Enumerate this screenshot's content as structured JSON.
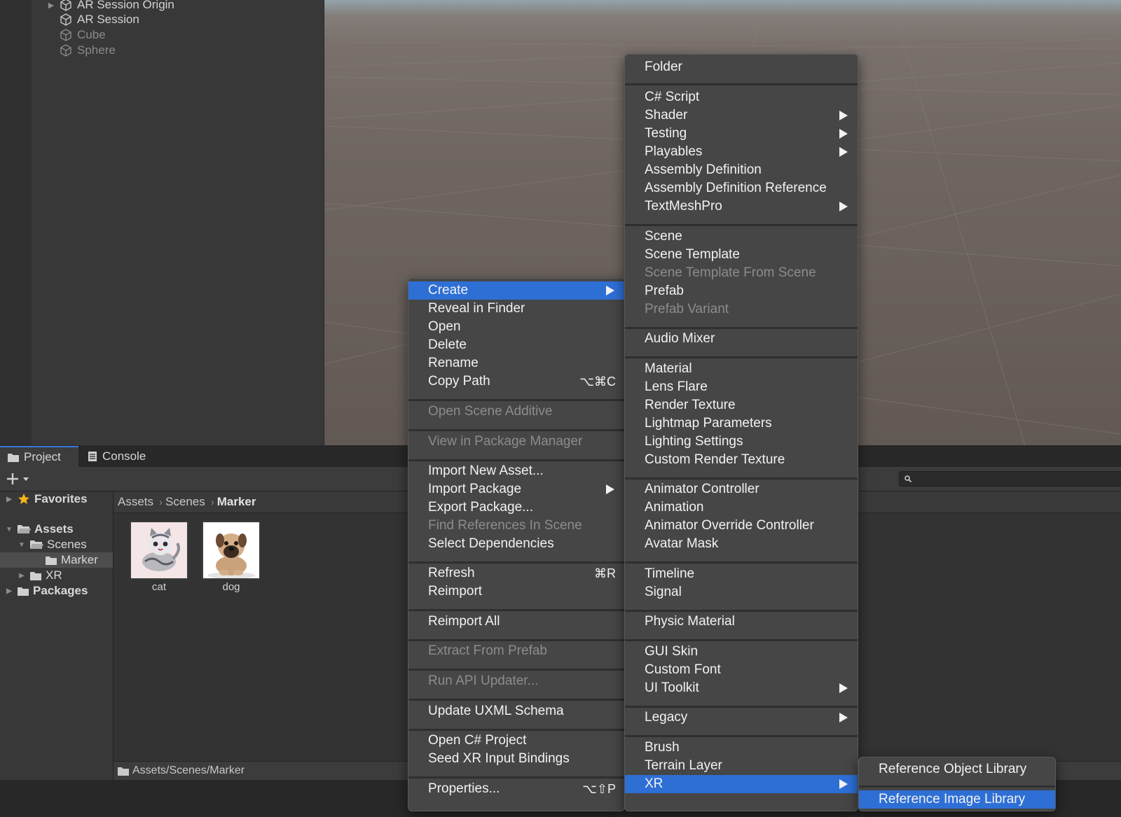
{
  "hierarchy": {
    "items": [
      {
        "label": "AR Session Origin",
        "dim": false,
        "arrow": true
      },
      {
        "label": "AR Session",
        "dim": false,
        "arrow": false
      },
      {
        "label": "Cube",
        "dim": true,
        "arrow": false
      },
      {
        "label": "Sphere",
        "dim": true,
        "arrow": false
      }
    ]
  },
  "project": {
    "tabs": [
      {
        "label": "Project",
        "icon": "folder-icon"
      },
      {
        "label": "Console",
        "icon": "console-icon"
      }
    ],
    "tree": {
      "favorites": "Favorites",
      "assets": "Assets",
      "scenes": "Scenes",
      "marker": "Marker",
      "xr": "XR",
      "packages": "Packages"
    },
    "breadcrumb": [
      "Assets",
      "Scenes",
      "Marker"
    ],
    "assets": [
      {
        "label": "cat"
      },
      {
        "label": "dog"
      }
    ],
    "status_path": "Assets/Scenes/Marker"
  },
  "context_menu": {
    "items": [
      {
        "label": "Create",
        "submenu": true,
        "highlighted": true
      },
      {
        "label": "Reveal in Finder"
      },
      {
        "label": "Open"
      },
      {
        "label": "Delete"
      },
      {
        "label": "Rename"
      },
      {
        "label": "Copy Path",
        "shortcut": "⌥⌘C"
      },
      {
        "label": "Open Scene Additive",
        "disabled": true
      },
      {
        "label": "View in Package Manager",
        "disabled": true
      },
      {
        "label": "Import New Asset..."
      },
      {
        "label": "Import Package",
        "submenu": true
      },
      {
        "label": "Export Package..."
      },
      {
        "label": "Find References In Scene",
        "disabled": true
      },
      {
        "label": "Select Dependencies"
      },
      {
        "label": "Refresh",
        "shortcut": "⌘R"
      },
      {
        "label": "Reimport"
      },
      {
        "label": "Reimport All"
      },
      {
        "label": "Extract From Prefab",
        "disabled": true
      },
      {
        "label": "Run API Updater...",
        "disabled": true
      },
      {
        "label": "Update UXML Schema"
      },
      {
        "label": "Open C# Project"
      },
      {
        "label": "Seed XR Input Bindings"
      },
      {
        "label": "Properties...",
        "shortcut": "⌥⇧P"
      }
    ]
  },
  "create_menu": {
    "items": [
      {
        "label": "Folder"
      },
      {
        "label": "C# Script"
      },
      {
        "label": "Shader",
        "submenu": true
      },
      {
        "label": "Testing",
        "submenu": true
      },
      {
        "label": "Playables",
        "submenu": true
      },
      {
        "label": "Assembly Definition"
      },
      {
        "label": "Assembly Definition Reference"
      },
      {
        "label": "TextMeshPro",
        "submenu": true
      },
      {
        "label": "Scene"
      },
      {
        "label": "Scene Template"
      },
      {
        "label": "Scene Template From Scene",
        "disabled": true
      },
      {
        "label": "Prefab"
      },
      {
        "label": "Prefab Variant",
        "disabled": true
      },
      {
        "label": "Audio Mixer"
      },
      {
        "label": "Material"
      },
      {
        "label": "Lens Flare"
      },
      {
        "label": "Render Texture"
      },
      {
        "label": "Lightmap Parameters"
      },
      {
        "label": "Lighting Settings"
      },
      {
        "label": "Custom Render Texture"
      },
      {
        "label": "Animator Controller"
      },
      {
        "label": "Animation"
      },
      {
        "label": "Animator Override Controller"
      },
      {
        "label": "Avatar Mask"
      },
      {
        "label": "Timeline"
      },
      {
        "label": "Signal"
      },
      {
        "label": "Physic Material"
      },
      {
        "label": "GUI Skin"
      },
      {
        "label": "Custom Font"
      },
      {
        "label": "UI Toolkit",
        "submenu": true
      },
      {
        "label": "Legacy",
        "submenu": true
      },
      {
        "label": "Brush"
      },
      {
        "label": "Terrain Layer"
      },
      {
        "label": "XR",
        "submenu": true,
        "highlighted": true
      }
    ]
  },
  "xr_menu": {
    "items": [
      {
        "label": "Reference Object Library"
      },
      {
        "label": "Reference Image Library",
        "highlighted": true
      }
    ]
  },
  "colors": {
    "highlight": "#2e6fd6",
    "menu_bg": "#464646",
    "panel_bg": "#383838"
  }
}
